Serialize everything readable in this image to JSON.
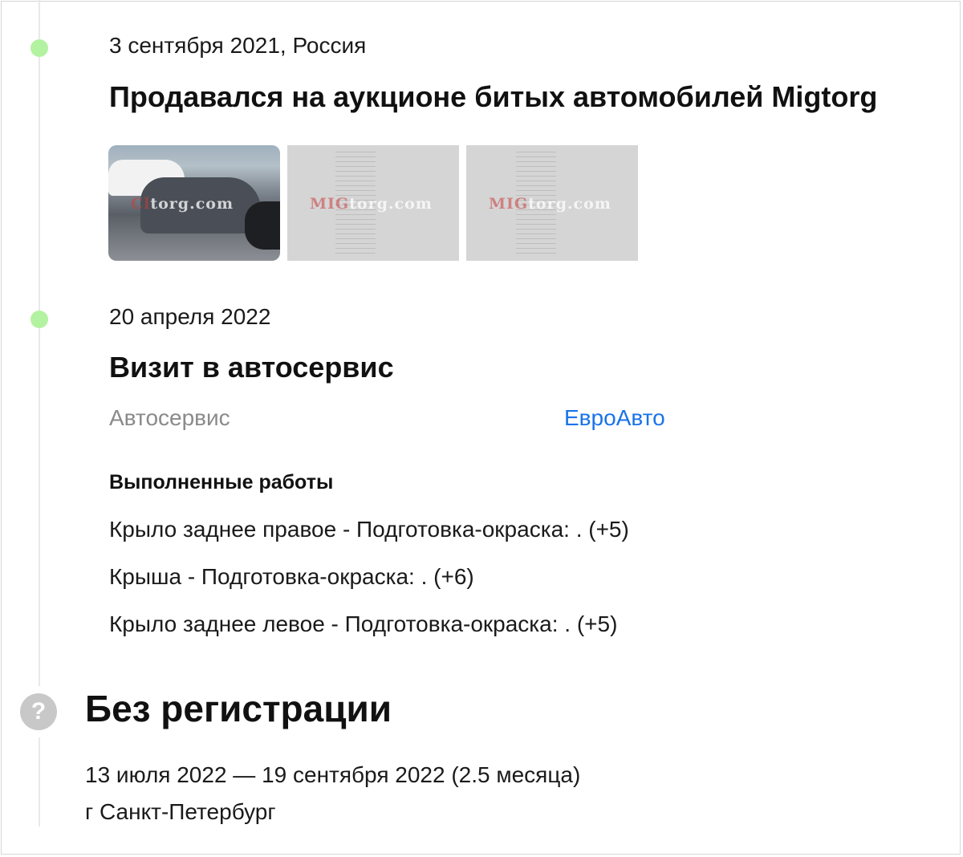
{
  "events": [
    {
      "date": "3 сентября 2021, Россия",
      "title": "Продавался на аукционе битых автомобилей Migtorg",
      "photos": [
        {
          "kind": "car-photo",
          "watermark_brand": "Cl",
          "watermark_rest": "torg.com"
        },
        {
          "kind": "document-scan",
          "watermark_brand": "MIG",
          "watermark_rest": "torg.com"
        },
        {
          "kind": "document-scan",
          "watermark_brand": "MIG",
          "watermark_rest": "torg.com"
        }
      ]
    },
    {
      "date": "20 апреля 2022",
      "title": "Визит в автосервис",
      "service_label": "Автосервис",
      "service_name": "ЕвроАвто",
      "works_heading": "Выполненные работы",
      "works": [
        "Крыло заднее правое - Подготовка-окраска: . (+5)",
        "Крыша - Подготовка-окраска: . (+6)",
        "Крыло заднее левое - Подготовка-окраска: . (+5)"
      ]
    }
  ],
  "registration": {
    "icon": "question-icon",
    "icon_glyph": "?",
    "title": "Без регистрации",
    "period": "13 июля 2022 — 19 сентября 2022 (2.5 месяца)",
    "city": "г Санкт-Петербург"
  },
  "colors": {
    "dot": "#b3f2a1",
    "link": "#1a73e8",
    "muted": "#8a8a8a",
    "timeline": "#e9e9e9"
  }
}
